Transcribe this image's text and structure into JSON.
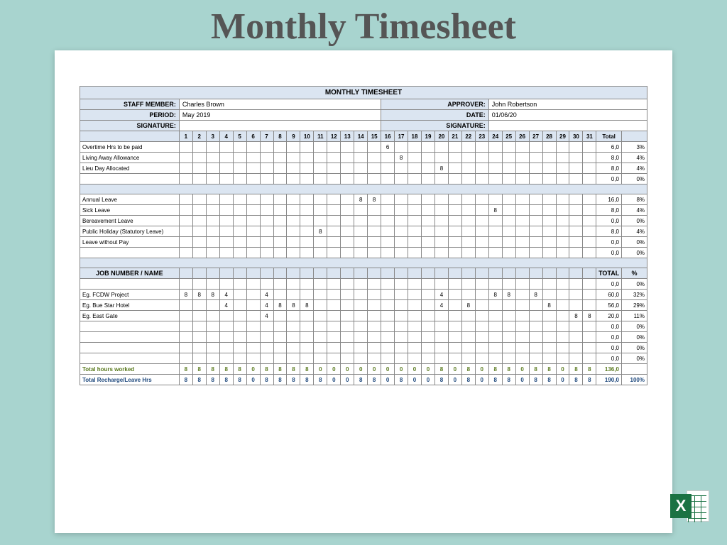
{
  "pageTitle": "Monthly Timesheet",
  "tableTitle": "MONTHLY TIMESHEET",
  "labels": {
    "staff": "STAFF MEMBER:",
    "approver": "APPROVER:",
    "period": "PERIOD:",
    "date": "DATE:",
    "sig": "SIGNATURE:",
    "sig2": "SIGNATURE:",
    "job": "JOB NUMBER / NAME",
    "total": "Total",
    "totalUpper": "TOTAL",
    "pct": "%",
    "worked": "Total hours worked",
    "recharge": "Total Recharge/Leave Hrs"
  },
  "fields": {
    "staff": "Charles Brown",
    "approver": "John Robertson",
    "period": "May 2019",
    "date": "01/06/20"
  },
  "days": [
    "1",
    "2",
    "3",
    "4",
    "5",
    "6",
    "7",
    "8",
    "9",
    "10",
    "11",
    "12",
    "13",
    "14",
    "15",
    "16",
    "17",
    "18",
    "19",
    "20",
    "21",
    "22",
    "23",
    "24",
    "25",
    "26",
    "27",
    "28",
    "29",
    "30",
    "31"
  ],
  "chart_data": {
    "type": "table",
    "title": "Monthly Timesheet Hours May 2019",
    "categories": [
      "1",
      "2",
      "3",
      "4",
      "5",
      "6",
      "7",
      "8",
      "9",
      "10",
      "11",
      "12",
      "13",
      "14",
      "15",
      "16",
      "17",
      "18",
      "19",
      "20",
      "21",
      "22",
      "23",
      "24",
      "25",
      "26",
      "27",
      "28",
      "29",
      "30",
      "31"
    ],
    "series": [
      {
        "name": "Overtime Hrs to be paid",
        "values": [
          "",
          "",
          "",
          "",
          "",
          "",
          "",
          "",
          "",
          "",
          "",
          "",
          "",
          "",
          "",
          "6",
          "",
          "",
          "",
          "",
          "",
          "",
          "",
          "",
          "",
          "",
          "",
          "",
          "",
          "",
          ""
        ],
        "total": "6,0",
        "pct": "3%"
      },
      {
        "name": "Living Away Allowance",
        "values": [
          "",
          "",
          "",
          "",
          "",
          "",
          "",
          "",
          "",
          "",
          "",
          "",
          "",
          "",
          "",
          "",
          "8",
          "",
          "",
          "",
          "",
          "",
          "",
          "",
          "",
          "",
          "",
          "",
          "",
          "",
          ""
        ],
        "total": "8,0",
        "pct": "4%"
      },
      {
        "name": "Lieu Day Allocated",
        "values": [
          "",
          "",
          "",
          "",
          "",
          "",
          "",
          "",
          "",
          "",
          "",
          "",
          "",
          "",
          "",
          "",
          "",
          "",
          "",
          "8",
          "",
          "",
          "",
          "",
          "",
          "",
          "",
          "",
          "",
          "",
          ""
        ],
        "total": "8,0",
        "pct": "4%"
      },
      {
        "name": "",
        "values": [
          "",
          "",
          "",
          "",
          "",
          "",
          "",
          "",
          "",
          "",
          "",
          "",
          "",
          "",
          "",
          "",
          "",
          "",
          "",
          "",
          "",
          "",
          "",
          "",
          "",
          "",
          "",
          "",
          "",
          "",
          ""
        ],
        "total": "0,0",
        "pct": "0%"
      },
      {
        "name": "Annual Leave",
        "values": [
          "",
          "",
          "",
          "",
          "",
          "",
          "",
          "",
          "",
          "",
          "",
          "",
          "",
          "8",
          "8",
          "",
          "",
          "",
          "",
          "",
          "",
          "",
          "",
          "",
          "",
          "",
          "",
          "",
          "",
          "",
          ""
        ],
        "total": "16,0",
        "pct": "8%"
      },
      {
        "name": "Sick Leave",
        "values": [
          "",
          "",
          "",
          "",
          "",
          "",
          "",
          "",
          "",
          "",
          "",
          "",
          "",
          "",
          "",
          "",
          "",
          "",
          "",
          "",
          "",
          "",
          "",
          "8",
          "",
          "",
          "",
          "",
          "",
          "",
          ""
        ],
        "total": "8,0",
        "pct": "4%"
      },
      {
        "name": "Bereavement Leave",
        "values": [
          "",
          "",
          "",
          "",
          "",
          "",
          "",
          "",
          "",
          "",
          "",
          "",
          "",
          "",
          "",
          "",
          "",
          "",
          "",
          "",
          "",
          "",
          "",
          "",
          "",
          "",
          "",
          "",
          "",
          "",
          ""
        ],
        "total": "0,0",
        "pct": "0%"
      },
      {
        "name": "Public Holiday (Statutory Leave)",
        "values": [
          "",
          "",
          "",
          "",
          "",
          "",
          "",
          "",
          "",
          "",
          "8",
          "",
          "",
          "",
          "",
          "",
          "",
          "",
          "",
          "",
          "",
          "",
          "",
          "",
          "",
          "",
          "",
          "",
          "",
          "",
          ""
        ],
        "total": "8,0",
        "pct": "4%"
      },
      {
        "name": "Leave without Pay",
        "values": [
          "",
          "",
          "",
          "",
          "",
          "",
          "",
          "",
          "",
          "",
          "",
          "",
          "",
          "",
          "",
          "",
          "",
          "",
          "",
          "",
          "",
          "",
          "",
          "",
          "",
          "",
          "",
          "",
          "",
          "",
          ""
        ],
        "total": "0,0",
        "pct": "0%"
      },
      {
        "name": "",
        "values": [
          "",
          "",
          "",
          "",
          "",
          "",
          "",
          "",
          "",
          "",
          "",
          "",
          "",
          "",
          "",
          "",
          "",
          "",
          "",
          "",
          "",
          "",
          "",
          "",
          "",
          "",
          "",
          "",
          "",
          "",
          ""
        ],
        "total": "0,0",
        "pct": "0%"
      },
      {
        "name": "",
        "values": [
          "",
          "",
          "",
          "",
          "",
          "",
          "",
          "",
          "",
          "",
          "",
          "",
          "",
          "",
          "",
          "",
          "",
          "",
          "",
          "",
          "",
          "",
          "",
          "",
          "",
          "",
          "",
          "",
          "",
          "",
          ""
        ],
        "total": "0,0",
        "pct": "0%"
      },
      {
        "name": "Eg. FCDW Project",
        "values": [
          "8",
          "8",
          "8",
          "4",
          "",
          "",
          "4",
          "",
          "",
          "",
          "",
          "",
          "",
          "",
          "",
          "",
          "",
          "",
          "",
          "4",
          "",
          "",
          "",
          "8",
          "8",
          "",
          "8",
          "",
          "",
          "",
          ""
        ],
        "total": "60,0",
        "pct": "32%"
      },
      {
        "name": "Eg. Bue Star Hotel",
        "values": [
          "",
          "",
          "",
          "4",
          "",
          "",
          "4",
          "8",
          "8",
          "8",
          "",
          "",
          "",
          "",
          "",
          "",
          "",
          "",
          "",
          "4",
          "",
          "8",
          "",
          "",
          "",
          "",
          "",
          "8",
          "",
          "",
          ""
        ],
        "total": "56,0",
        "pct": "29%"
      },
      {
        "name": "Eg. East Gate",
        "values": [
          "",
          "",
          "",
          "",
          "",
          "",
          "4",
          "",
          "",
          "",
          "",
          "",
          "",
          "",
          "",
          "",
          "",
          "",
          "",
          "",
          "",
          "",
          "",
          "",
          "",
          "",
          "",
          "",
          "",
          "8",
          "8"
        ],
        "total": "20,0",
        "pct": "11%"
      },
      {
        "name": "",
        "values": [
          "",
          "",
          "",
          "",
          "",
          "",
          "",
          "",
          "",
          "",
          "",
          "",
          "",
          "",
          "",
          "",
          "",
          "",
          "",
          "",
          "",
          "",
          "",
          "",
          "",
          "",
          "",
          "",
          "",
          "",
          ""
        ],
        "total": "0,0",
        "pct": "0%"
      },
      {
        "name": "",
        "values": [
          "",
          "",
          "",
          "",
          "",
          "",
          "",
          "",
          "",
          "",
          "",
          "",
          "",
          "",
          "",
          "",
          "",
          "",
          "",
          "",
          "",
          "",
          "",
          "",
          "",
          "",
          "",
          "",
          "",
          "",
          ""
        ],
        "total": "0,0",
        "pct": "0%"
      },
      {
        "name": "",
        "values": [
          "",
          "",
          "",
          "",
          "",
          "",
          "",
          "",
          "",
          "",
          "",
          "",
          "",
          "",
          "",
          "",
          "",
          "",
          "",
          "",
          "",
          "",
          "",
          "",
          "",
          "",
          "",
          "",
          "",
          "",
          ""
        ],
        "total": "0,0",
        "pct": "0%"
      },
      {
        "name": "",
        "values": [
          "",
          "",
          "",
          "",
          "",
          "",
          "",
          "",
          "",
          "",
          "",
          "",
          "",
          "",
          "",
          "",
          "",
          "",
          "",
          "",
          "",
          "",
          "",
          "",
          "",
          "",
          "",
          "",
          "",
          "",
          ""
        ],
        "total": "0,0",
        "pct": "0%"
      }
    ],
    "totals": {
      "worked": {
        "values": [
          "8",
          "8",
          "8",
          "8",
          "8",
          "0",
          "8",
          "8",
          "8",
          "8",
          "0",
          "0",
          "0",
          "0",
          "0",
          "0",
          "0",
          "0",
          "0",
          "8",
          "0",
          "8",
          "0",
          "8",
          "8",
          "0",
          "8",
          "8",
          "0",
          "8",
          "8"
        ],
        "total": "136,0",
        "pct": ""
      },
      "recharge": {
        "values": [
          "8",
          "8",
          "8",
          "8",
          "8",
          "0",
          "8",
          "8",
          "8",
          "8",
          "8",
          "0",
          "0",
          "8",
          "8",
          "0",
          "8",
          "0",
          "0",
          "8",
          "0",
          "8",
          "0",
          "8",
          "8",
          "0",
          "8",
          "8",
          "0",
          "8",
          "8"
        ],
        "total": "190,0",
        "pct": "100%"
      }
    }
  }
}
